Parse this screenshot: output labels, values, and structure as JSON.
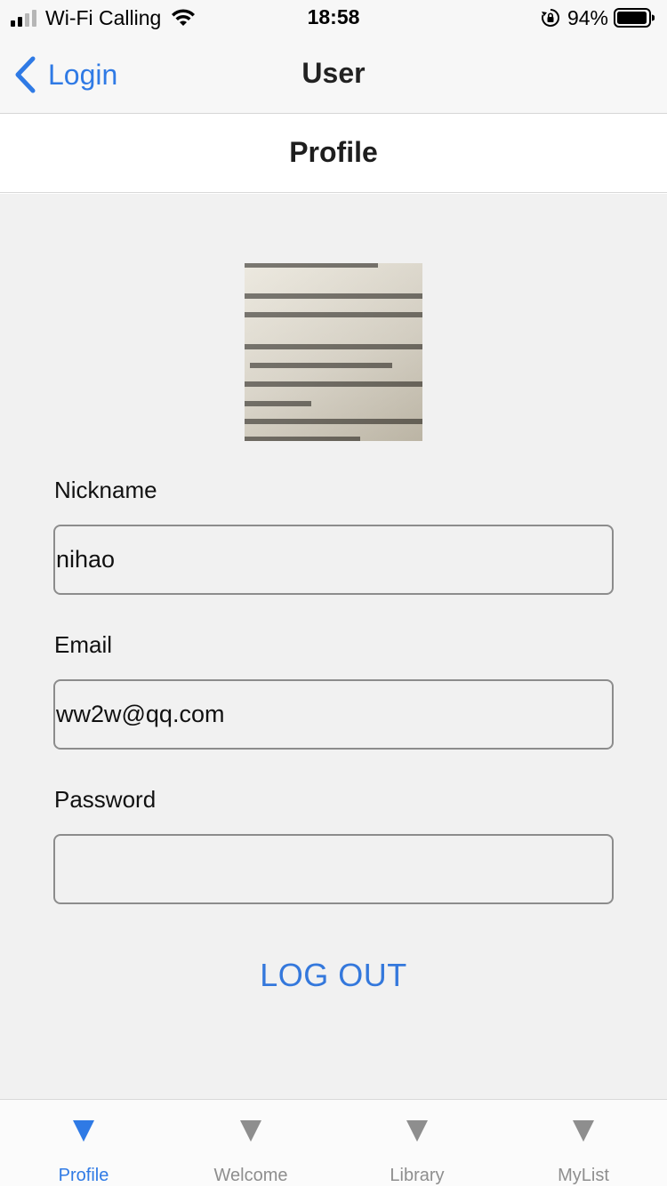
{
  "status_bar": {
    "carrier": "Wi-Fi Calling",
    "time": "18:58",
    "battery": "94%",
    "icons": [
      "signal-icon",
      "wifi-icon",
      "orientation-lock-icon",
      "battery-icon"
    ]
  },
  "nav": {
    "back_label": "Login",
    "title": "User",
    "back_icon": "chevron-left-icon"
  },
  "header": {
    "title": "Profile"
  },
  "profile": {
    "avatar_icon": "profile-photo",
    "nickname_label": "Nickname",
    "nickname_value": "nihao",
    "email_label": "Email",
    "email_value": "ww2w@qq.com",
    "password_label": "Password",
    "password_value": "",
    "logout_label": "LOG OUT"
  },
  "tabs": [
    {
      "label": "Profile",
      "icon": "triangle-down-icon",
      "active": true
    },
    {
      "label": "Welcome",
      "icon": "triangle-down-icon",
      "active": false
    },
    {
      "label": "Library",
      "icon": "triangle-down-icon",
      "active": false
    },
    {
      "label": "MyList",
      "icon": "triangle-down-icon",
      "active": false
    }
  ],
  "colors": {
    "accent": "#2f7ae5",
    "inactive_tab": "#8e8e8e",
    "content_bg": "#f1f1f1"
  }
}
